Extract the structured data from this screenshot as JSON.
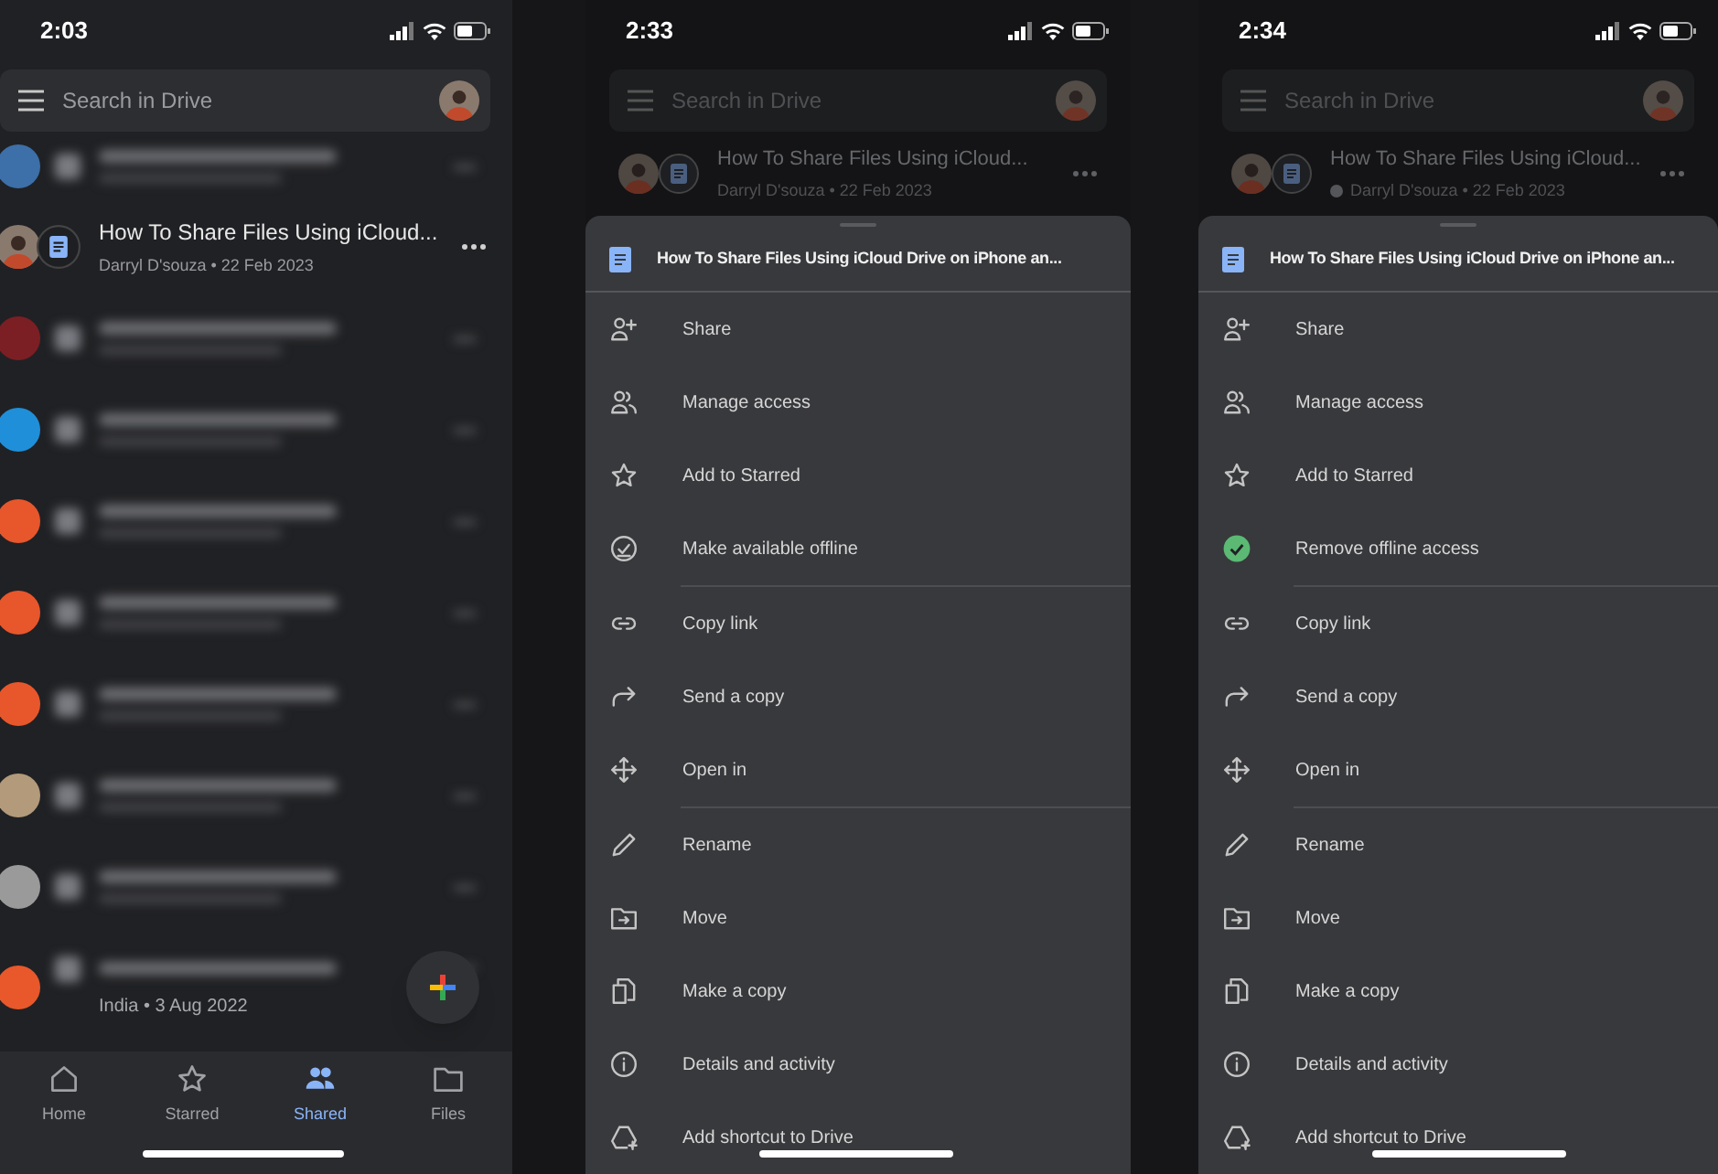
{
  "screens": [
    {
      "kind": "file_list",
      "time": "2:03",
      "search": {
        "placeholder": "Search in Drive"
      },
      "files": [
        {
          "kind": "blurred",
          "color": "#3d6fa8"
        },
        {
          "kind": "file",
          "title": "How To Share Files Using iCloud...",
          "subtitle": "Darryl D'souza • 22 Feb 2023"
        },
        {
          "kind": "blurred",
          "color": "#7b1f24"
        },
        {
          "kind": "blurred",
          "color": "#1f8fd9"
        },
        {
          "kind": "blurred",
          "color": "#e8562b"
        },
        {
          "kind": "blurred",
          "color": "#e8562c"
        },
        {
          "kind": "blurred",
          "color": "#e8572b"
        },
        {
          "kind": "blurred",
          "color": "#b39a7a"
        },
        {
          "kind": "blurred",
          "color": "#9a9a9a"
        },
        {
          "kind": "blurred",
          "color": "#e8582b",
          "subtitle": "India • 3 Aug 2022"
        }
      ],
      "nav": [
        {
          "kind": "home",
          "label": "Home",
          "selected": false
        },
        {
          "kind": "star",
          "label": "Starred",
          "selected": false
        },
        {
          "kind": "shared",
          "label": "Shared",
          "selected": true
        },
        {
          "kind": "files",
          "label": "Files",
          "selected": false
        }
      ]
    },
    {
      "kind": "file_actions",
      "time": "2:33",
      "search": {
        "placeholder": "Search in Drive"
      },
      "file": {
        "title": "How To Share Files Using iCloud...",
        "subtitle": "Darryl D'souza • 22 Feb 2023",
        "offline": false
      },
      "sheet": {
        "title": "How To Share Files Using iCloud Drive on iPhone an...",
        "sections": [
          [
            {
              "kind": "share",
              "label": "Share"
            },
            {
              "kind": "manage",
              "label": "Manage access"
            },
            {
              "kind": "star",
              "label": "Add to Starred"
            },
            {
              "kind": "offline",
              "label": "Make available offline",
              "checked": false
            }
          ],
          [
            {
              "kind": "link",
              "label": "Copy link"
            },
            {
              "kind": "send",
              "label": "Send a copy"
            },
            {
              "kind": "open",
              "label": "Open in"
            }
          ],
          [
            {
              "kind": "rename",
              "label": "Rename"
            },
            {
              "kind": "move",
              "label": "Move"
            },
            {
              "kind": "copy",
              "label": "Make a copy"
            },
            {
              "kind": "details",
              "label": "Details and activity"
            },
            {
              "kind": "shortcut",
              "label": "Add shortcut to Drive"
            }
          ]
        ]
      }
    },
    {
      "kind": "file_actions",
      "time": "2:34",
      "search": {
        "placeholder": "Search in Drive"
      },
      "file": {
        "title": "How To Share Files Using iCloud...",
        "subtitle": "Darryl D'souza • 22 Feb 2023",
        "offline": true
      },
      "sheet": {
        "title": "How To Share Files Using iCloud Drive on iPhone an...",
        "sections": [
          [
            {
              "kind": "share",
              "label": "Share"
            },
            {
              "kind": "manage",
              "label": "Manage access"
            },
            {
              "kind": "star",
              "label": "Add to Starred"
            },
            {
              "kind": "offline",
              "label": "Remove offline access",
              "checked": true
            }
          ],
          [
            {
              "kind": "link",
              "label": "Copy link"
            },
            {
              "kind": "send",
              "label": "Send a copy"
            },
            {
              "kind": "open",
              "label": "Open in"
            }
          ],
          [
            {
              "kind": "rename",
              "label": "Rename"
            },
            {
              "kind": "move",
              "label": "Move"
            },
            {
              "kind": "copy",
              "label": "Make a copy"
            },
            {
              "kind": "details",
              "label": "Details and activity"
            },
            {
              "kind": "shortcut",
              "label": "Add shortcut to Drive"
            }
          ]
        ]
      }
    }
  ]
}
